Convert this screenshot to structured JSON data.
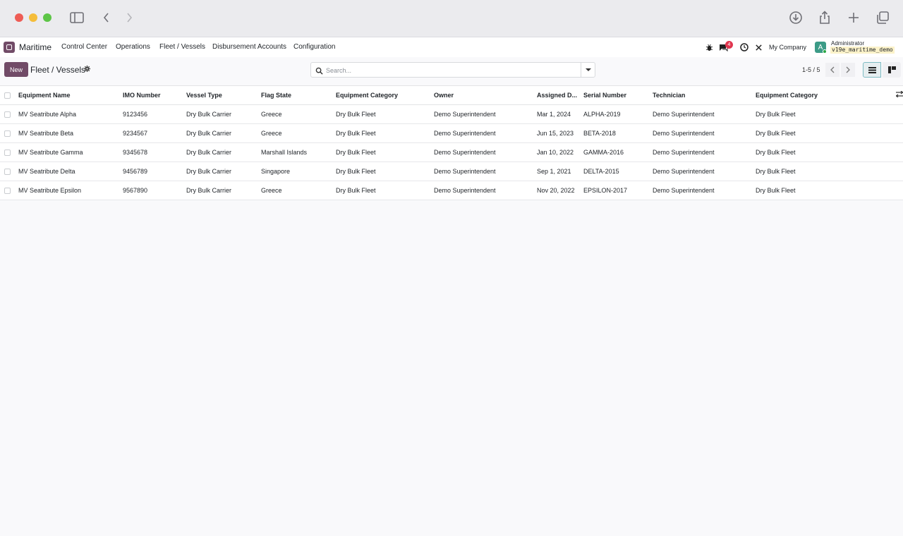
{
  "browser": {
    "icons": [
      "sidebar-icon",
      "back-icon",
      "forward-icon",
      "download-icon",
      "share-icon",
      "plus-icon",
      "tabs-icon"
    ]
  },
  "navbar": {
    "app_name": "Maritime",
    "menu": [
      "Control Center",
      "Operations",
      "Fleet / Vessels",
      "Disbursement Accounts",
      "Configuration"
    ],
    "message_count": "4",
    "company": "My Company",
    "avatar_letter": "A",
    "user": "Administrator",
    "database": "v19e_maritime_demo"
  },
  "control": {
    "new_label": "New",
    "title": "Fleet / Vessels",
    "search_placeholder": "Search...",
    "pager": "1-5 / 5"
  },
  "table": {
    "columns": [
      "Equipment Name",
      "IMO Number",
      "Vessel Type",
      "Flag State",
      "Equipment Category",
      "Owner",
      "Assigned D...",
      "Serial Number",
      "Technician",
      "Equipment Category"
    ],
    "rows": [
      [
        "MV Seatribute Alpha",
        "9123456",
        "Dry Bulk Carrier",
        "Greece",
        "Dry Bulk Fleet",
        "Demo Superintendent",
        "Mar 1, 2024",
        "ALPHA-2019",
        "Demo Superintendent",
        "Dry Bulk Fleet"
      ],
      [
        "MV Seatribute Beta",
        "9234567",
        "Dry Bulk Carrier",
        "Greece",
        "Dry Bulk Fleet",
        "Demo Superintendent",
        "Jun 15, 2023",
        "BETA-2018",
        "Demo Superintendent",
        "Dry Bulk Fleet"
      ],
      [
        "MV Seatribute Gamma",
        "9345678",
        "Dry Bulk Carrier",
        "Marshall Islands",
        "Dry Bulk Fleet",
        "Demo Superintendent",
        "Jan 10, 2022",
        "GAMMA-2016",
        "Demo Superintendent",
        "Dry Bulk Fleet"
      ],
      [
        "MV Seatribute Delta",
        "9456789",
        "Dry Bulk Carrier",
        "Singapore",
        "Dry Bulk Fleet",
        "Demo Superintendent",
        "Sep 1, 2021",
        "DELTA-2015",
        "Demo Superintendent",
        "Dry Bulk Fleet"
      ],
      [
        "MV Seatribute Epsilon",
        "9567890",
        "Dry Bulk Carrier",
        "Greece",
        "Dry Bulk Fleet",
        "Demo Superintendent",
        "Nov 20, 2022",
        "EPSILON-2017",
        "Demo Superintendent",
        "Dry Bulk Fleet"
      ]
    ]
  },
  "colors": {
    "brand": "#714b67",
    "badge": "#e0364f",
    "avatar": "#3c9b87"
  }
}
